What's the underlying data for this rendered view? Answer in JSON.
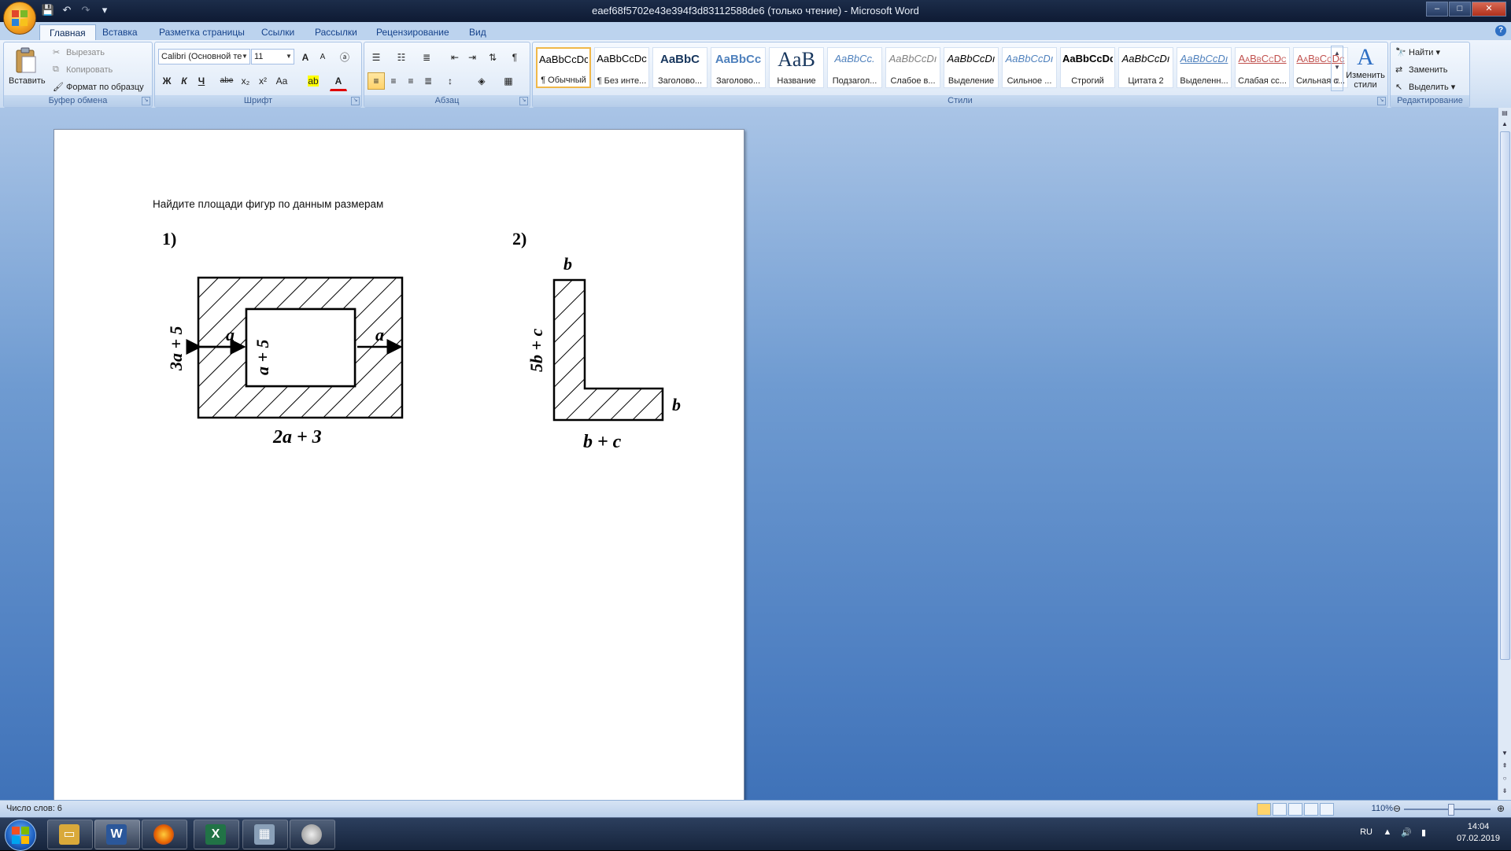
{
  "window": {
    "title": "eaef68f5702e43e394f3d83112588de6 (только чтение) - Microsoft Word",
    "qat": [
      "save-icon",
      "undo-icon",
      "redo-icon",
      "customize-icon"
    ],
    "controls": {
      "minimize": "–",
      "maximize": "□",
      "close": "✕"
    }
  },
  "tabs": [
    "Главная",
    "Вставка",
    "Разметка страницы",
    "Ссылки",
    "Рассылки",
    "Рецензирование",
    "Вид"
  ],
  "ribbon": {
    "clipboard": {
      "label": "Буфер обмена",
      "paste": "Вставить",
      "cut": "Вырезать",
      "copy": "Копировать",
      "format_painter": "Формат по образцу"
    },
    "font": {
      "label": "Шрифт",
      "font_name": "Calibri (Основной те",
      "font_size": "11",
      "bold": "Ж",
      "italic": "К",
      "underline": "Ч",
      "strike": "abe",
      "subscript": "x₂",
      "superscript": "x²",
      "case": "Aa",
      "grow": "A",
      "shrink": "A",
      "clear": "ⓐ"
    },
    "paragraph": {
      "label": "Абзац"
    },
    "styles": {
      "label": "Стили",
      "items": [
        {
          "preview": "AaBbCcDc",
          "name": "¶ Обычный",
          "color": "#000000"
        },
        {
          "preview": "AaBbCcDc",
          "name": "¶ Без инте...",
          "color": "#000000"
        },
        {
          "preview": "AaBbC",
          "name": "Заголово...",
          "color": "#17365d"
        },
        {
          "preview": "AaBbCc",
          "name": "Заголово...",
          "color": "#4f81bd"
        },
        {
          "preview": "AaB",
          "name": "Название",
          "color": "#17365d"
        },
        {
          "preview": "AaBbCc.",
          "name": "Подзагол...",
          "color": "#4f81bd"
        },
        {
          "preview": "AaBbCcDı",
          "name": "Слабое в...",
          "color": "#808080"
        },
        {
          "preview": "AaBbCcDı",
          "name": "Выделение",
          "color": "#000000"
        },
        {
          "preview": "AaBbCcDı",
          "name": "Сильное ...",
          "color": "#4f81bd"
        },
        {
          "preview": "AaBbCcDc",
          "name": "Строгий",
          "color": "#000000"
        },
        {
          "preview": "AaBbCcDı",
          "name": "Цитата 2",
          "color": "#000000"
        },
        {
          "preview": "AaBbCcDı",
          "name": "Выделенн...",
          "color": "#4f81bd"
        },
        {
          "preview": "AaBbCcDc",
          "name": "Слабая сс...",
          "color": "#c0504d"
        },
        {
          "preview": "AaBbCcDc",
          "name": "Сильная с...",
          "color": "#c0504d"
        }
      ],
      "change_styles": "Изменить стили"
    },
    "editing": {
      "label": "Редактирование",
      "find": "Найти",
      "replace": "Заменить",
      "select": "Выделить"
    }
  },
  "document": {
    "text": "Найдите площади фигур по данным размерам",
    "fig1": {
      "number": "1)",
      "left_label": "3a + 5",
      "inner_label": "a + 5",
      "a_left": "a",
      "a_right": "a",
      "bottom_label": "2a + 3"
    },
    "fig2": {
      "number": "2)",
      "top_label": "b",
      "left_label": "5b + c",
      "right_label": "b",
      "bottom_label": "b + c"
    }
  },
  "status": {
    "word_count": "Число слов: 6",
    "zoom": "110%"
  },
  "taskbar": {
    "apps": [
      "start",
      "explorer",
      "word",
      "firefox",
      "excel",
      "calculator",
      "media"
    ],
    "lang": "RU",
    "time": "14:04",
    "date": "07.02.2019"
  }
}
